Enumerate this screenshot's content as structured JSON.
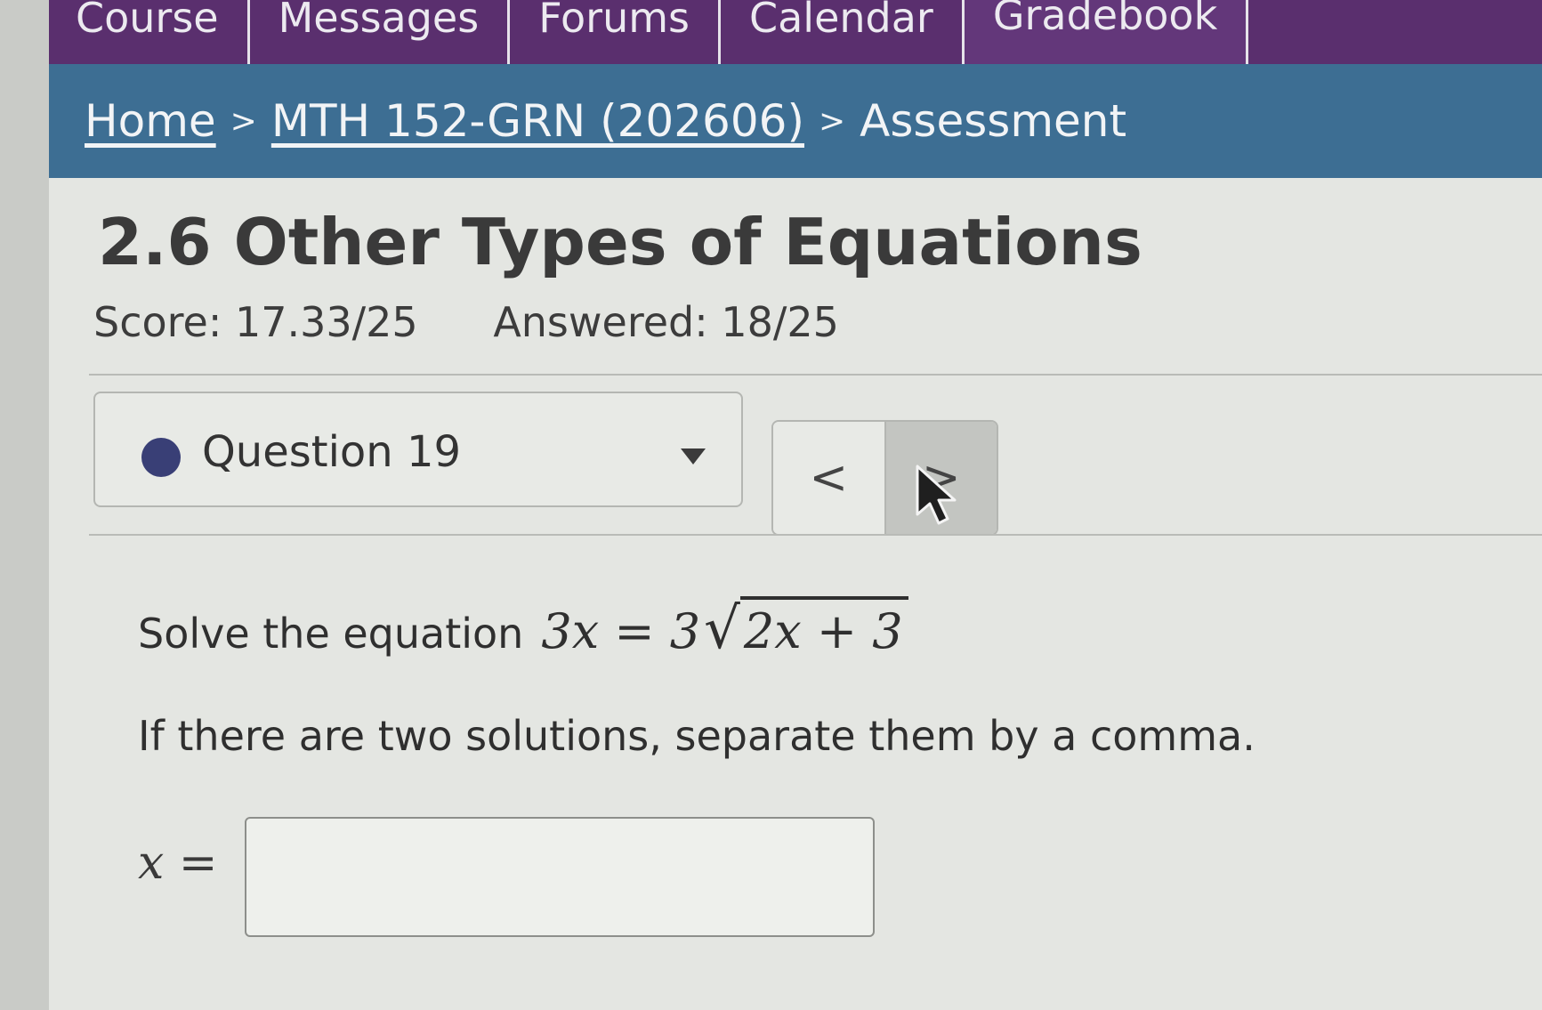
{
  "nav": {
    "tabs": [
      "Course",
      "Messages",
      "Forums",
      "Calendar",
      "Gradebook"
    ]
  },
  "breadcrumb": {
    "home": "Home",
    "sep": ">",
    "course": "MTH 152-GRN (202606)",
    "current": "Assessment"
  },
  "assessment": {
    "title": "2.6 Other Types of Equations",
    "score": "Score: 17.33/25",
    "answered": "Answered: 18/25"
  },
  "question_selector": {
    "label": "Question 19",
    "prev_label": "<",
    "next_label": ">"
  },
  "question": {
    "prompt": "Solve the equation",
    "equation_lhs": "3x = 3",
    "radical_symbol": "√",
    "equation_radicand": "2x + 3",
    "instruction": "If there are two solutions, separate them by a comma.",
    "answer_label": "x =",
    "answer_value": ""
  },
  "colors": {
    "nav_bg": "#5a2f6e",
    "breadcrumb_bg": "#3d6e93",
    "status_dot": "#393f76"
  }
}
